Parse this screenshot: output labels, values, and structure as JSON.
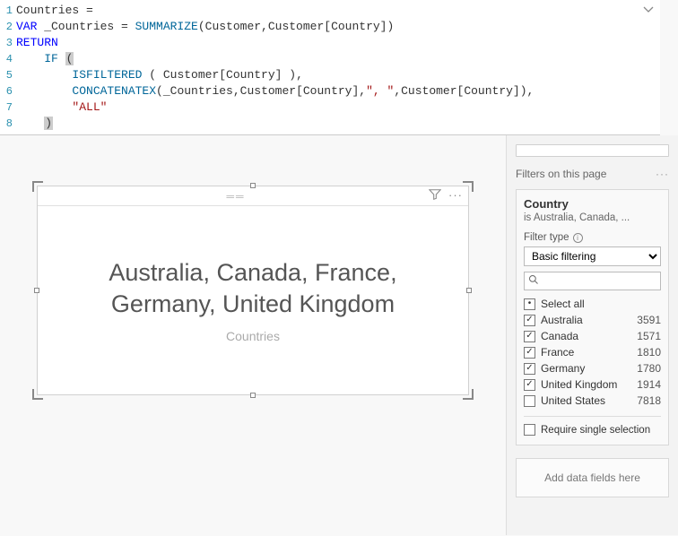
{
  "code": {
    "lines": [
      {
        "n": 1,
        "segments": [
          {
            "t": "Countries = ",
            "c": ""
          }
        ]
      },
      {
        "n": 2,
        "segments": [
          {
            "t": "VAR",
            "c": "kw-var"
          },
          {
            "t": " _Countries = ",
            "c": ""
          },
          {
            "t": "SUMMARIZE",
            "c": "kw-func"
          },
          {
            "t": "(Customer,Customer[Country])",
            "c": ""
          }
        ]
      },
      {
        "n": 3,
        "segments": [
          {
            "t": "RETURN",
            "c": "kw-ret"
          }
        ]
      },
      {
        "n": 4,
        "segments": [
          {
            "t": "    ",
            "c": ""
          },
          {
            "t": "IF",
            "c": "kw-func"
          },
          {
            "t": " ",
            "c": ""
          },
          {
            "t": "(",
            "c": "hl-paren"
          }
        ]
      },
      {
        "n": 5,
        "segments": [
          {
            "t": "        ",
            "c": ""
          },
          {
            "t": "ISFILTERED",
            "c": "kw-func"
          },
          {
            "t": " ( Customer[Country] ),",
            "c": ""
          }
        ]
      },
      {
        "n": 6,
        "segments": [
          {
            "t": "        ",
            "c": ""
          },
          {
            "t": "CONCATENATEX",
            "c": "kw-func"
          },
          {
            "t": "(_Countries,Customer[Country],",
            "c": ""
          },
          {
            "t": "\", \"",
            "c": "str"
          },
          {
            "t": ",Customer[Country]),",
            "c": ""
          }
        ]
      },
      {
        "n": 7,
        "segments": [
          {
            "t": "        ",
            "c": ""
          },
          {
            "t": "\"ALL\"",
            "c": "str"
          }
        ]
      },
      {
        "n": 8,
        "segments": [
          {
            "t": "    ",
            "c": ""
          },
          {
            "t": ")",
            "c": "hl-paren"
          }
        ]
      }
    ]
  },
  "visual": {
    "value": "Australia, Canada, France, Germany, United Kingdom",
    "label": "Countries"
  },
  "filters": {
    "panel_title": "Filters on this page",
    "card": {
      "title": "Country",
      "subtitle": "is Australia, Canada, ...",
      "filter_type_label": "Filter type",
      "filter_type_value": "Basic filtering",
      "search_placeholder": "",
      "select_all_label": "Select all",
      "items": [
        {
          "label": "Australia",
          "count": "3591",
          "checked": true
        },
        {
          "label": "Canada",
          "count": "1571",
          "checked": true
        },
        {
          "label": "France",
          "count": "1810",
          "checked": true
        },
        {
          "label": "Germany",
          "count": "1780",
          "checked": true
        },
        {
          "label": "United Kingdom",
          "count": "1914",
          "checked": true
        },
        {
          "label": "United States",
          "count": "7818",
          "checked": false
        }
      ],
      "require_single_label": "Require single selection"
    },
    "add_fields_placeholder": "Add data fields here"
  }
}
